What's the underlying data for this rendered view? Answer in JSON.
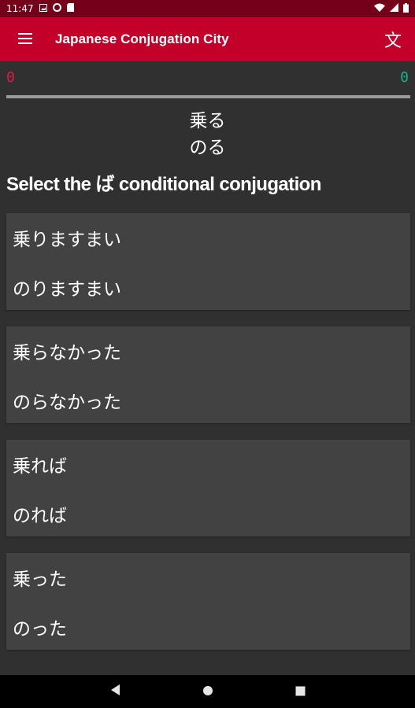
{
  "status_bar": {
    "time": "11:47"
  },
  "app_bar": {
    "title": "Japanese Conjugation City",
    "dictionary_icon_glyph": "文"
  },
  "score": {
    "wrong": "0",
    "right": "0"
  },
  "word": {
    "kanji": "乗る",
    "kana": "のる"
  },
  "prompt": "Select the ば conditional conjugation",
  "options": [
    {
      "kanji": "乗りますまい",
      "kana": "のりますまい"
    },
    {
      "kanji": "乗らなかった",
      "kana": "のらなかった"
    },
    {
      "kanji": "乗れば",
      "kana": "のれば"
    },
    {
      "kanji": "乗った",
      "kana": "のった"
    }
  ],
  "colors": {
    "app_bar": "#c2002a",
    "status_bar": "#75001a",
    "background": "#303030",
    "card": "#424242",
    "wrong_score": "#d81b49",
    "right_score": "#16b38a"
  },
  "icons": {
    "status_bar": [
      "gallery-icon",
      "data-saver-icon",
      "sd-card-icon",
      "wifi-icon",
      "signal-icon",
      "battery-icon"
    ],
    "app_bar": [
      "menu-icon",
      "dictionary-icon"
    ],
    "nav_bar": [
      "back-icon",
      "home-icon",
      "recents-icon"
    ]
  }
}
